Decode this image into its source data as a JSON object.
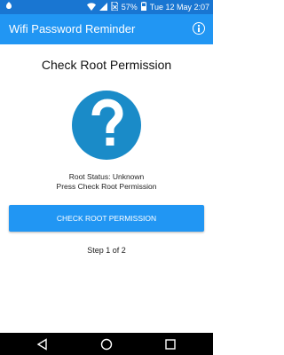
{
  "status_bar": {
    "battery_percent": "57%",
    "datetime": "Tue 12 May 2:07",
    "icons": [
      "notification-icon",
      "wifi-icon",
      "signal-icon",
      "no-sim-icon",
      "battery-icon"
    ]
  },
  "app_bar": {
    "title": "Wifi Password Reminder",
    "info_icon": "info-icon",
    "color": "#2196f3"
  },
  "main": {
    "heading": "Check Root Permission",
    "icon": "question-mark-icon",
    "icon_color": "#1a8bc8",
    "root_status": "Root Status: Unknown",
    "instruction": "Press Check Root Permission",
    "button_label": "CHECK ROOT PERMISSION",
    "step": "Step 1 of 2"
  },
  "nav_bar": {
    "buttons": [
      "back-icon",
      "home-icon",
      "recents-icon"
    ]
  }
}
